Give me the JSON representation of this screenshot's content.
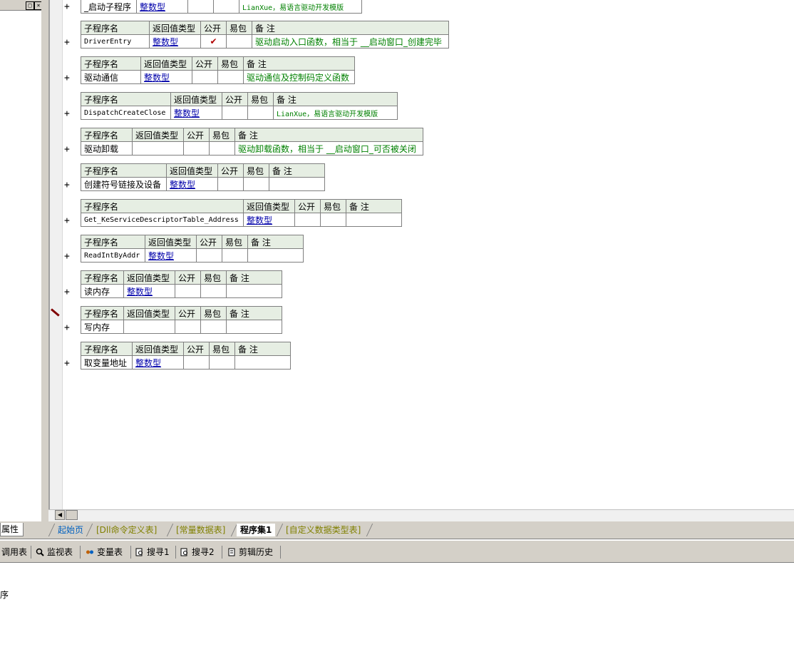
{
  "tabs": {
    "properties": "属性",
    "sheets": [
      {
        "label": "起始页",
        "state": "first"
      },
      {
        "label": "[Dll命令定义表]",
        "state": "inactive"
      },
      {
        "label": "[常量数据表]",
        "state": "inactive"
      },
      {
        "label": "程序集1",
        "state": "active"
      },
      {
        "label": "[自定义数据类型表]",
        "state": "inactive"
      }
    ]
  },
  "toolbar": {
    "call_table": "调用表",
    "watch": "监视表",
    "variables": "变量表",
    "search1": "搜寻1",
    "search2": "搜寻2",
    "clip_history": "剪辑历史"
  },
  "output": {
    "text": "序"
  },
  "headers": {
    "name": "子程序名",
    "ret": "返回值类型",
    "pub": "公开",
    "easy": "易包",
    "remark": "备 注"
  },
  "plus": "+",
  "check": "✔",
  "subs": [
    {
      "name": "_启动子程序",
      "ret": "整数型",
      "pub": "",
      "remark": "LianXue，易语言驱动开发模版"
    },
    {
      "name": "DriverEntry",
      "ret": "整数型",
      "pub": "✔",
      "remark": "驱动启动入口函数，相当于 __启动窗口_创建完毕"
    },
    {
      "name": "驱动通信",
      "ret": "整数型",
      "pub": "",
      "remark": "驱动通信及控制码定义函数"
    },
    {
      "name": "DispatchCreateClose",
      "ret": "整数型",
      "pub": "",
      "remark": "LianXue，易语言驱动开发模版"
    },
    {
      "name": "驱动卸载",
      "ret": "",
      "pub": "",
      "remark": "驱动卸载函数，相当于 __启动窗口_可否被关闭"
    },
    {
      "name": "创建符号链接及设备",
      "ret": "整数型",
      "pub": "",
      "remark": ""
    },
    {
      "name": "Get_KeServiceDescriptorTable_Address",
      "ret": "整数型",
      "pub": "",
      "remark": ""
    },
    {
      "name": "ReadIntByAddr",
      "ret": "整数型",
      "pub": "",
      "remark": ""
    },
    {
      "name": "读内存",
      "ret": "整数型",
      "pub": "",
      "remark": ""
    },
    {
      "name": "写内存",
      "ret": "",
      "pub": "",
      "remark": ""
    },
    {
      "name": "取变量地址",
      "ret": "整数型",
      "pub": "",
      "remark": ""
    }
  ]
}
